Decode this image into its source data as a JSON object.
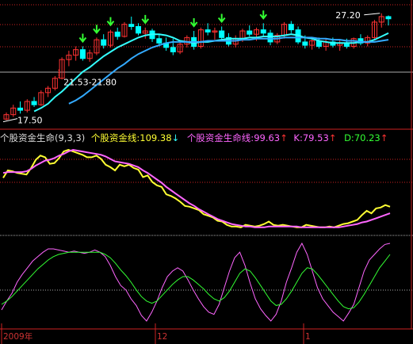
{
  "chart_data": [
    {
      "type": "candlestick",
      "panel": "price",
      "annotations": [
        {
          "text": "27.20",
          "kind": "high"
        },
        {
          "text": "21.53-21.80",
          "kind": "gap"
        },
        {
          "text": "17.50",
          "kind": "low"
        }
      ],
      "candles": [
        {
          "o": 17.6,
          "h": 18.2,
          "l": 17.5,
          "c": 18.0
        },
        {
          "o": 18.0,
          "h": 18.9,
          "l": 17.8,
          "c": 18.6
        },
        {
          "o": 18.6,
          "h": 19.2,
          "l": 18.1,
          "c": 18.4
        },
        {
          "o": 18.4,
          "h": 19.4,
          "l": 18.2,
          "c": 19.2
        },
        {
          "o": 19.2,
          "h": 19.6,
          "l": 18.7,
          "c": 18.9
        },
        {
          "o": 18.9,
          "h": 20.2,
          "l": 18.8,
          "c": 20.0
        },
        {
          "o": 20.0,
          "h": 20.6,
          "l": 19.6,
          "c": 20.4
        },
        {
          "o": 20.4,
          "h": 21.5,
          "l": 20.2,
          "c": 21.3
        },
        {
          "o": 21.3,
          "h": 23.2,
          "l": 21.2,
          "c": 23.0
        },
        {
          "o": 23.0,
          "h": 23.8,
          "l": 22.4,
          "c": 23.4
        },
        {
          "o": 23.4,
          "h": 24.2,
          "l": 22.9,
          "c": 23.9
        },
        {
          "o": 23.9,
          "h": 24.2,
          "l": 22.9,
          "c": 23.1
        },
        {
          "o": 23.1,
          "h": 23.9,
          "l": 22.8,
          "c": 23.6
        },
        {
          "o": 23.6,
          "h": 25.0,
          "l": 23.4,
          "c": 24.8
        },
        {
          "o": 24.8,
          "h": 25.3,
          "l": 24.0,
          "c": 24.3
        },
        {
          "o": 24.3,
          "h": 25.7,
          "l": 24.1,
          "c": 25.5
        },
        {
          "o": 25.5,
          "h": 25.9,
          "l": 24.8,
          "c": 25.1
        },
        {
          "o": 25.1,
          "h": 26.4,
          "l": 25.0,
          "c": 26.2
        },
        {
          "o": 26.2,
          "h": 26.9,
          "l": 25.7,
          "c": 26.0
        },
        {
          "o": 26.0,
          "h": 26.3,
          "l": 25.2,
          "c": 25.4
        },
        {
          "o": 25.4,
          "h": 25.9,
          "l": 24.9,
          "c": 25.6
        },
        {
          "o": 25.6,
          "h": 25.8,
          "l": 24.6,
          "c": 24.9
        },
        {
          "o": 24.9,
          "h": 25.3,
          "l": 24.2,
          "c": 24.5
        },
        {
          "o": 24.5,
          "h": 25.0,
          "l": 23.8,
          "c": 24.1
        },
        {
          "o": 24.1,
          "h": 24.9,
          "l": 23.4,
          "c": 23.7
        },
        {
          "o": 23.7,
          "h": 24.6,
          "l": 23.5,
          "c": 24.4
        },
        {
          "o": 24.4,
          "h": 25.2,
          "l": 24.1,
          "c": 25.0
        },
        {
          "o": 25.0,
          "h": 25.6,
          "l": 23.9,
          "c": 24.2
        },
        {
          "o": 24.2,
          "h": 25.9,
          "l": 24.0,
          "c": 25.7
        },
        {
          "o": 25.7,
          "h": 26.3,
          "l": 25.2,
          "c": 25.5
        },
        {
          "o": 25.5,
          "h": 25.9,
          "l": 24.8,
          "c": 25.6
        },
        {
          "o": 25.6,
          "h": 26.0,
          "l": 24.7,
          "c": 25.0
        },
        {
          "o": 25.0,
          "h": 25.4,
          "l": 24.2,
          "c": 24.4
        },
        {
          "o": 24.4,
          "h": 25.2,
          "l": 24.1,
          "c": 24.9
        },
        {
          "o": 24.9,
          "h": 25.8,
          "l": 24.6,
          "c": 25.6
        },
        {
          "o": 25.6,
          "h": 26.1,
          "l": 25.1,
          "c": 25.3
        },
        {
          "o": 25.3,
          "h": 25.9,
          "l": 24.7,
          "c": 25.7
        },
        {
          "o": 25.7,
          "h": 26.3,
          "l": 25.1,
          "c": 25.4
        },
        {
          "o": 25.4,
          "h": 25.7,
          "l": 24.3,
          "c": 24.6
        },
        {
          "o": 24.6,
          "h": 25.4,
          "l": 24.4,
          "c": 25.2
        },
        {
          "o": 25.2,
          "h": 26.4,
          "l": 24.9,
          "c": 26.2
        },
        {
          "o": 26.2,
          "h": 26.5,
          "l": 25.4,
          "c": 25.7
        },
        {
          "o": 25.7,
          "h": 26.0,
          "l": 24.4,
          "c": 24.6
        },
        {
          "o": 24.6,
          "h": 25.2,
          "l": 24.0,
          "c": 24.3
        },
        {
          "o": 24.3,
          "h": 25.0,
          "l": 23.9,
          "c": 24.7
        },
        {
          "o": 24.7,
          "h": 25.0,
          "l": 24.0,
          "c": 24.2
        },
        {
          "o": 24.2,
          "h": 24.9,
          "l": 23.8,
          "c": 24.6
        },
        {
          "o": 24.6,
          "h": 25.0,
          "l": 24.1,
          "c": 24.3
        },
        {
          "o": 24.3,
          "h": 24.8,
          "l": 23.8,
          "c": 24.5
        },
        {
          "o": 24.5,
          "h": 24.9,
          "l": 24.0,
          "c": 24.2
        },
        {
          "o": 24.2,
          "h": 25.0,
          "l": 24.0,
          "c": 24.9
        },
        {
          "o": 24.9,
          "h": 25.3,
          "l": 24.3,
          "c": 24.5
        },
        {
          "o": 24.5,
          "h": 25.2,
          "l": 24.2,
          "c": 25.0
        },
        {
          "o": 25.0,
          "h": 26.6,
          "l": 24.8,
          "c": 26.4
        },
        {
          "o": 26.4,
          "h": 27.2,
          "l": 25.9,
          "c": 26.9
        },
        {
          "o": 26.9,
          "h": 27.0,
          "l": 26.1,
          "c": 26.7
        }
      ],
      "ma_series": [
        {
          "values": [
            null,
            null,
            null,
            null,
            18.3,
            18.6,
            19.0,
            19.6,
            20.1,
            20.7,
            21.3,
            21.9,
            22.3,
            22.8,
            23.3,
            23.7,
            24.1,
            24.4,
            24.7,
            25.0,
            25.2,
            25.3,
            25.3,
            25.2,
            25.0,
            24.7,
            24.6,
            24.5,
            24.6,
            24.6,
            24.7,
            24.8,
            24.9,
            24.9,
            24.9,
            25.0,
            25.0,
            25.1,
            25.1,
            25.1,
            25.2,
            25.3,
            25.2,
            25.0,
            24.9,
            24.7,
            24.6,
            24.5,
            24.5,
            24.5,
            24.5,
            24.6,
            24.6,
            24.8,
            25.1,
            25.4
          ]
        },
        {
          "values": [
            null,
            null,
            null,
            null,
            null,
            null,
            null,
            null,
            null,
            19.0,
            19.3,
            19.7,
            20.2,
            20.7,
            21.2,
            21.7,
            22.2,
            22.6,
            23.1,
            23.5,
            23.8,
            24.1,
            24.3,
            24.5,
            24.6,
            24.6,
            24.6,
            24.6,
            24.6,
            24.7,
            24.7,
            24.7,
            24.7,
            24.7,
            24.8,
            24.8,
            24.9,
            24.9,
            24.9,
            24.9,
            25.0,
            25.0,
            25.0,
            25.0,
            25.0,
            24.9,
            24.9,
            24.8,
            24.8,
            24.7,
            24.7,
            24.6,
            24.6,
            24.6,
            24.7,
            24.8
          ]
        }
      ],
      "buy_signal_bars": [
        11,
        13,
        15,
        20,
        27,
        31,
        37
      ]
    },
    {
      "type": "line",
      "panel": "indicator",
      "legend": {
        "title": "个股资金生命(9,3,3)",
        "items": [
          {
            "label": "个股资金线:",
            "value": "109.38",
            "arrow": "↓",
            "color": "#ffff33",
            "arrow_color": "#33ffff"
          },
          {
            "label": "个股资金生命线:",
            "value": "99.63",
            "arrow": "↑",
            "color": "#ff66ff",
            "arrow_color": "#ff3333"
          },
          {
            "label": "K:",
            "value": "79.53",
            "arrow": "↑",
            "color": "#ff66ff",
            "arrow_color": "#ff3333"
          },
          {
            "label": "D:",
            "value": "70.23",
            "arrow": "↑",
            "color": "#33ff33",
            "arrow_color": "#ff3333"
          }
        ]
      },
      "series": [
        {
          "name": "个股资金线",
          "values": [
            95,
            104,
            103,
            101,
            100,
            99,
            107,
            117,
            122,
            120,
            112,
            113,
            119,
            127,
            129,
            127,
            125,
            123,
            120,
            120,
            122,
            118,
            111,
            108,
            104,
            111,
            109,
            111,
            107,
            105,
            96,
            98,
            90,
            86,
            84,
            75,
            73,
            70,
            66,
            61,
            60,
            58,
            56,
            51,
            49,
            47,
            43,
            42,
            38,
            36,
            36,
            35,
            38,
            37,
            36,
            37,
            39,
            42,
            38,
            37,
            38,
            37,
            36,
            35,
            35,
            38,
            37,
            36,
            35,
            35,
            36,
            35,
            37,
            39,
            40,
            42,
            44,
            50,
            55,
            52,
            58,
            59,
            62,
            60
          ]
        },
        {
          "name": "个股资金生命线",
          "values": [
            101,
            102,
            102,
            102,
            102,
            103,
            106,
            110,
            113,
            116,
            117,
            119,
            122,
            124,
            127,
            129,
            128,
            127,
            126,
            125,
            124,
            123,
            121,
            118,
            115,
            114,
            113,
            112,
            110,
            108,
            104,
            101,
            97,
            93,
            89,
            84,
            80,
            76,
            72,
            68,
            64,
            61,
            57,
            54,
            51,
            48,
            45,
            43,
            41,
            39,
            38,
            37,
            36,
            36,
            35,
            35,
            35,
            36,
            36,
            36,
            36,
            36,
            36,
            36,
            35,
            35,
            35,
            35,
            35,
            35,
            35,
            35,
            35,
            36,
            37,
            38,
            39,
            41,
            42,
            44,
            46,
            48,
            50,
            52
          ]
        },
        {
          "name": "K",
          "values": [
            20,
            28,
            35,
            45,
            52,
            58,
            64,
            68,
            72,
            75,
            75,
            74,
            73,
            72,
            73,
            72,
            71,
            72,
            74,
            72,
            68,
            60,
            50,
            42,
            38,
            30,
            24,
            15,
            10,
            18,
            28,
            40,
            50,
            55,
            58,
            55,
            47,
            38,
            30,
            23,
            18,
            16,
            25,
            40,
            55,
            67,
            72,
            60,
            44,
            30,
            21,
            15,
            10,
            16,
            28,
            45,
            58,
            72,
            80,
            70,
            55,
            40,
            30,
            24,
            18,
            14,
            10,
            17,
            25,
            40,
            55,
            65,
            70,
            75,
            79,
            80
          ]
        },
        {
          "name": "D",
          "values": [
            25,
            28,
            32,
            37,
            42,
            47,
            52,
            57,
            61,
            65,
            68,
            70,
            71,
            72,
            72,
            72,
            72,
            72,
            72,
            72,
            70,
            67,
            62,
            56,
            51,
            45,
            38,
            32,
            28,
            26,
            28,
            33,
            38,
            43,
            47,
            50,
            50,
            47,
            43,
            39,
            34,
            30,
            28,
            31,
            37,
            45,
            53,
            57,
            55,
            49,
            42,
            35,
            28,
            24,
            25,
            30,
            37,
            45,
            53,
            58,
            57,
            52,
            46,
            40,
            34,
            28,
            23,
            21,
            22,
            27,
            34,
            42,
            50,
            58,
            64,
            70
          ]
        }
      ],
      "x_ticks": [
        "2009年",
        "12",
        "1"
      ]
    }
  ],
  "colors": {
    "up": "#ff3333",
    "down": "#00ffff",
    "ma_short": "#33ffff",
    "ma_long": "#33aaff",
    "grid": "#cc2222",
    "axis": "#dddddd"
  }
}
